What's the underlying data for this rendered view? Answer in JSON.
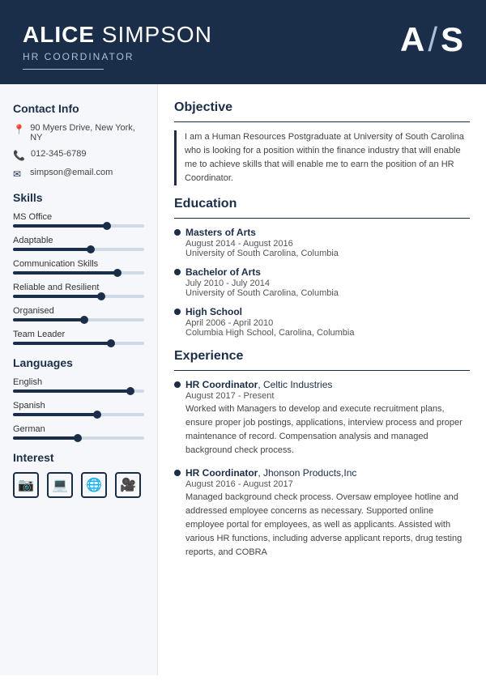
{
  "header": {
    "first_name": "ALICE",
    "last_name": "SIMPSON",
    "title": "HR COORDINATOR",
    "initial_a": "A",
    "initial_slash": "/",
    "initial_s": "S"
  },
  "sidebar": {
    "contact_section": "Contact Info",
    "address": "90 Myers Drive, New York, NY",
    "phone": "012-345-6789",
    "email": "simpson@email.com",
    "skills_section": "Skills",
    "skills": [
      {
        "label": "MS Office",
        "fill": 72
      },
      {
        "label": "Adaptable",
        "fill": 60
      },
      {
        "label": "Communication Skills",
        "fill": 80
      },
      {
        "label": "Reliable and Resilient",
        "fill": 68
      },
      {
        "label": "Organised",
        "fill": 55
      },
      {
        "label": "Team Leader",
        "fill": 75
      }
    ],
    "languages_section": "Languages",
    "languages": [
      {
        "label": "English",
        "fill": 90
      },
      {
        "label": "Spanish",
        "fill": 65
      },
      {
        "label": "German",
        "fill": 50
      }
    ],
    "interest_section": "Interest"
  },
  "main": {
    "objective_section": "Objective",
    "objective_text": "I am a Human Resources Postgraduate at University of South Carolina who is looking for a position within the finance industry that will enable me to achieve skills that will enable me to earn the position of an HR Coordinator.",
    "education_section": "Education",
    "education": [
      {
        "degree": "Masters of Arts",
        "dates": "August 2014 - August 2016",
        "school": "University of South Carolina, Columbia"
      },
      {
        "degree": "Bachelor of Arts",
        "dates": "July 2010 - July 2014",
        "school": "University of South Carolina, Columbia"
      },
      {
        "degree": "High School",
        "dates": "April 2006 - April 2010",
        "school": "Columbia High School, Carolina, Columbia"
      }
    ],
    "experience_section": "Experience",
    "experience": [
      {
        "role": "HR Coordinator",
        "company": ", Celtic Industries",
        "dates": "August 2017 - Present",
        "description": "Worked with Managers to develop and execute recruitment plans, ensure proper job postings, applications, interview process and proper maintenance of record. Compensation analysis and managed background check process."
      },
      {
        "role": "HR Coordinator",
        "company": ", Jhonson Products,Inc",
        "dates": "August 2016 - August 2017",
        "description": "Managed background check process. Oversaw employee hotline and addressed employee concerns as necessary. Supported online employee portal for employees, as well as applicants. Assisted with various HR functions, including adverse applicant reports, drug testing reports, and COBRA"
      }
    ]
  }
}
